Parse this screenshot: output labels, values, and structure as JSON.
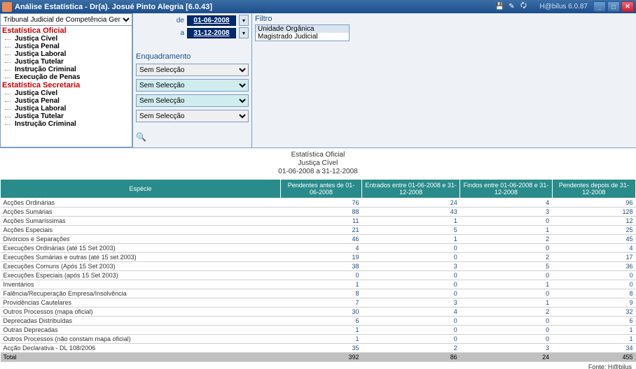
{
  "titlebar": {
    "title": "Análise Estatística - Dr(a). Josué Pinto Alegria [6.0.43]",
    "version": "H@bilus 6.0.87"
  },
  "tribunal_select": "Tribunal Judicial de Competência Genéric",
  "tree": {
    "group1": "Estatística Oficial",
    "items1": [
      "Justiça Cível",
      "Justiça Penal",
      "Justiça Laboral",
      "Justiça Tutelar",
      "Instrução Criminal",
      "Execução de Penas"
    ],
    "group2": "Estatística Secretaria",
    "items2": [
      "Justiça Cível",
      "Justiça Penal",
      "Justiça Laboral",
      "Justiça Tutelar",
      "Instrução Criminal"
    ]
  },
  "dates": {
    "de_label": "de",
    "de": "01-06-2008",
    "a_label": "a",
    "a": "31-12-2008"
  },
  "enquadramento": {
    "header": "Enquadramento",
    "opt": "Sem Selecção"
  },
  "filtro": {
    "header": "Filtro",
    "items": [
      "Unidade Orgânica",
      "Magistrado Judicial"
    ]
  },
  "report": {
    "title1": "Estatística Oficial",
    "title2": "Justiça Cível",
    "title3": "01-06-2008 a 31-12-2008",
    "columns": [
      "Espécie",
      "Pendentes antes de 01-06-2008",
      "Entrados entre 01-06-2008 e 31-12-2008",
      "Findos entre 01-06-2008 e 31-12-2008",
      "Pendentes depois de 31-12-2008"
    ],
    "rows": [
      {
        "label": "Acções Ordinárias",
        "v": [
          76,
          24,
          4,
          96
        ]
      },
      {
        "label": "Acções Sumárias",
        "v": [
          88,
          43,
          3,
          128
        ]
      },
      {
        "label": "Acções Sumaríssimas",
        "v": [
          11,
          1,
          0,
          12
        ]
      },
      {
        "label": "Acções Especiais",
        "v": [
          21,
          5,
          1,
          25
        ]
      },
      {
        "label": "Divórcios e Separações",
        "v": [
          46,
          1,
          2,
          45
        ]
      },
      {
        "label": "Execuções Ordinárias (até 15 Set 2003)",
        "v": [
          4,
          0,
          0,
          4
        ]
      },
      {
        "label": "Execuções Sumárias e outras (até 15 set 2003)",
        "v": [
          19,
          0,
          2,
          17
        ]
      },
      {
        "label": "Execuções Comuns (Após 15 Set 2003)",
        "v": [
          38,
          3,
          5,
          36
        ]
      },
      {
        "label": "Execuções Especiais (após 15 Set 2003)",
        "v": [
          0,
          0,
          0,
          0
        ]
      },
      {
        "label": "Inventários",
        "v": [
          1,
          0,
          1,
          0
        ]
      },
      {
        "label": "Falência/Recuperação Empresa/Insolvência",
        "v": [
          8,
          0,
          0,
          8
        ]
      },
      {
        "label": "Providências Cautelares",
        "v": [
          7,
          3,
          1,
          9
        ]
      },
      {
        "label": "Outros Processos (mapa oficial)",
        "v": [
          30,
          4,
          2,
          32
        ]
      },
      {
        "label": "Deprecadas Distribuídas",
        "v": [
          6,
          0,
          0,
          6
        ]
      },
      {
        "label": "Outras Deprecadas",
        "v": [
          1,
          0,
          0,
          1
        ]
      },
      {
        "label": "Outros Processos (não constam mapa oficial)",
        "v": [
          1,
          0,
          0,
          1
        ]
      },
      {
        "label": "Acção Declarativa - DL 108/2006",
        "v": [
          35,
          2,
          3,
          34
        ]
      }
    ],
    "total": {
      "label": "Total",
      "v": [
        392,
        86,
        24,
        455
      ]
    },
    "footer": "Fonte: H@bilus"
  }
}
